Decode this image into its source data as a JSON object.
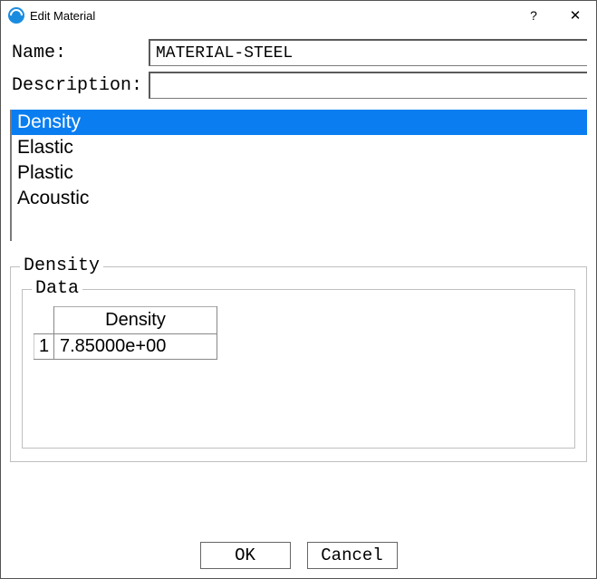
{
  "window": {
    "title": "Edit Material"
  },
  "fields": {
    "name_label": "Name:",
    "name_value": "MATERIAL-STEEL",
    "description_label": "Description:",
    "description_value": ""
  },
  "property_list": {
    "items": [
      "Density",
      "Elastic",
      "Plastic",
      "Acoustic"
    ],
    "selected_index": 0
  },
  "density_panel": {
    "legend": "Density",
    "data_legend": "Data",
    "table": {
      "column_header": "Density",
      "row_header": "1",
      "value": "7.85000e+00"
    }
  },
  "buttons": {
    "ok": "OK",
    "cancel": "Cancel"
  }
}
